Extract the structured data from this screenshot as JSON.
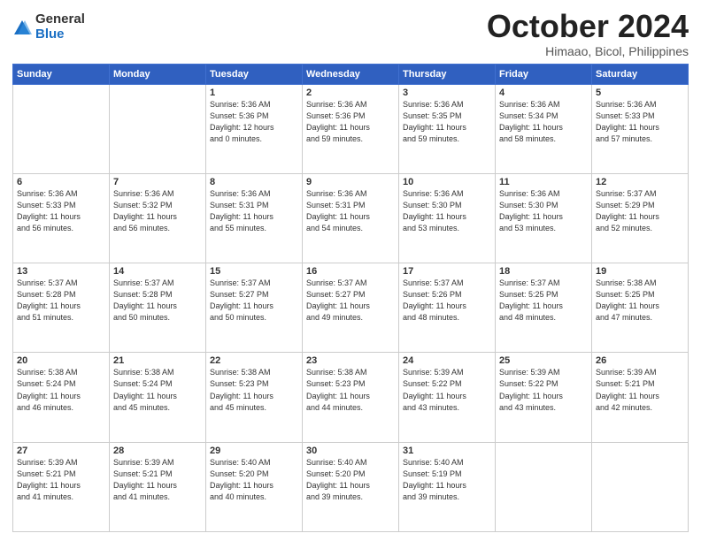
{
  "logo": {
    "general": "General",
    "blue": "Blue"
  },
  "title": "October 2024",
  "location": "Himaao, Bicol, Philippines",
  "headers": [
    "Sunday",
    "Monday",
    "Tuesday",
    "Wednesday",
    "Thursday",
    "Friday",
    "Saturday"
  ],
  "weeks": [
    [
      {
        "day": "",
        "info": ""
      },
      {
        "day": "",
        "info": ""
      },
      {
        "day": "1",
        "info": "Sunrise: 5:36 AM\nSunset: 5:36 PM\nDaylight: 12 hours\nand 0 minutes."
      },
      {
        "day": "2",
        "info": "Sunrise: 5:36 AM\nSunset: 5:36 PM\nDaylight: 11 hours\nand 59 minutes."
      },
      {
        "day": "3",
        "info": "Sunrise: 5:36 AM\nSunset: 5:35 PM\nDaylight: 11 hours\nand 59 minutes."
      },
      {
        "day": "4",
        "info": "Sunrise: 5:36 AM\nSunset: 5:34 PM\nDaylight: 11 hours\nand 58 minutes."
      },
      {
        "day": "5",
        "info": "Sunrise: 5:36 AM\nSunset: 5:33 PM\nDaylight: 11 hours\nand 57 minutes."
      }
    ],
    [
      {
        "day": "6",
        "info": "Sunrise: 5:36 AM\nSunset: 5:33 PM\nDaylight: 11 hours\nand 56 minutes."
      },
      {
        "day": "7",
        "info": "Sunrise: 5:36 AM\nSunset: 5:32 PM\nDaylight: 11 hours\nand 56 minutes."
      },
      {
        "day": "8",
        "info": "Sunrise: 5:36 AM\nSunset: 5:31 PM\nDaylight: 11 hours\nand 55 minutes."
      },
      {
        "day": "9",
        "info": "Sunrise: 5:36 AM\nSunset: 5:31 PM\nDaylight: 11 hours\nand 54 minutes."
      },
      {
        "day": "10",
        "info": "Sunrise: 5:36 AM\nSunset: 5:30 PM\nDaylight: 11 hours\nand 53 minutes."
      },
      {
        "day": "11",
        "info": "Sunrise: 5:36 AM\nSunset: 5:30 PM\nDaylight: 11 hours\nand 53 minutes."
      },
      {
        "day": "12",
        "info": "Sunrise: 5:37 AM\nSunset: 5:29 PM\nDaylight: 11 hours\nand 52 minutes."
      }
    ],
    [
      {
        "day": "13",
        "info": "Sunrise: 5:37 AM\nSunset: 5:28 PM\nDaylight: 11 hours\nand 51 minutes."
      },
      {
        "day": "14",
        "info": "Sunrise: 5:37 AM\nSunset: 5:28 PM\nDaylight: 11 hours\nand 50 minutes."
      },
      {
        "day": "15",
        "info": "Sunrise: 5:37 AM\nSunset: 5:27 PM\nDaylight: 11 hours\nand 50 minutes."
      },
      {
        "day": "16",
        "info": "Sunrise: 5:37 AM\nSunset: 5:27 PM\nDaylight: 11 hours\nand 49 minutes."
      },
      {
        "day": "17",
        "info": "Sunrise: 5:37 AM\nSunset: 5:26 PM\nDaylight: 11 hours\nand 48 minutes."
      },
      {
        "day": "18",
        "info": "Sunrise: 5:37 AM\nSunset: 5:25 PM\nDaylight: 11 hours\nand 48 minutes."
      },
      {
        "day": "19",
        "info": "Sunrise: 5:38 AM\nSunset: 5:25 PM\nDaylight: 11 hours\nand 47 minutes."
      }
    ],
    [
      {
        "day": "20",
        "info": "Sunrise: 5:38 AM\nSunset: 5:24 PM\nDaylight: 11 hours\nand 46 minutes."
      },
      {
        "day": "21",
        "info": "Sunrise: 5:38 AM\nSunset: 5:24 PM\nDaylight: 11 hours\nand 45 minutes."
      },
      {
        "day": "22",
        "info": "Sunrise: 5:38 AM\nSunset: 5:23 PM\nDaylight: 11 hours\nand 45 minutes."
      },
      {
        "day": "23",
        "info": "Sunrise: 5:38 AM\nSunset: 5:23 PM\nDaylight: 11 hours\nand 44 minutes."
      },
      {
        "day": "24",
        "info": "Sunrise: 5:39 AM\nSunset: 5:22 PM\nDaylight: 11 hours\nand 43 minutes."
      },
      {
        "day": "25",
        "info": "Sunrise: 5:39 AM\nSunset: 5:22 PM\nDaylight: 11 hours\nand 43 minutes."
      },
      {
        "day": "26",
        "info": "Sunrise: 5:39 AM\nSunset: 5:21 PM\nDaylight: 11 hours\nand 42 minutes."
      }
    ],
    [
      {
        "day": "27",
        "info": "Sunrise: 5:39 AM\nSunset: 5:21 PM\nDaylight: 11 hours\nand 41 minutes."
      },
      {
        "day": "28",
        "info": "Sunrise: 5:39 AM\nSunset: 5:21 PM\nDaylight: 11 hours\nand 41 minutes."
      },
      {
        "day": "29",
        "info": "Sunrise: 5:40 AM\nSunset: 5:20 PM\nDaylight: 11 hours\nand 40 minutes."
      },
      {
        "day": "30",
        "info": "Sunrise: 5:40 AM\nSunset: 5:20 PM\nDaylight: 11 hours\nand 39 minutes."
      },
      {
        "day": "31",
        "info": "Sunrise: 5:40 AM\nSunset: 5:19 PM\nDaylight: 11 hours\nand 39 minutes."
      },
      {
        "day": "",
        "info": ""
      },
      {
        "day": "",
        "info": ""
      }
    ]
  ]
}
